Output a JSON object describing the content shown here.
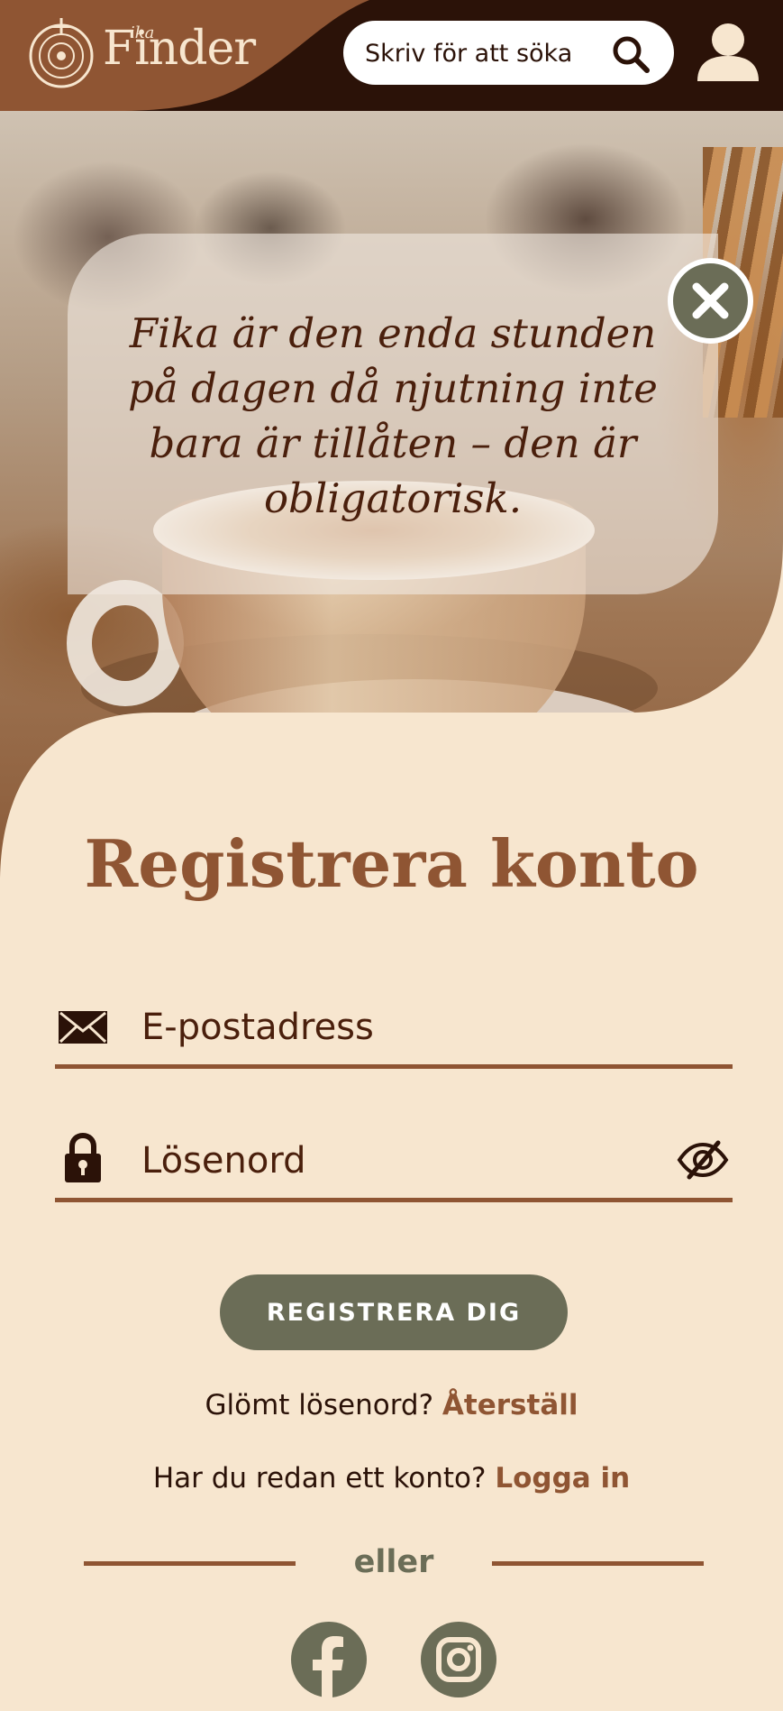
{
  "header": {
    "logo_big": "Finder",
    "logo_small": "ika",
    "search": {
      "placeholder": "Skriv för att söka"
    }
  },
  "hero": {
    "quote": "Fika är den enda stunden på dagen då njutning inte bara är tillåten – den är obligatorisk."
  },
  "form": {
    "title": "Registrera konto",
    "email_placeholder": "E-postadress",
    "password_placeholder": "Lösenord",
    "register_label": "REGISTRERA DIG",
    "forgot_text": "Glömt lösenord?",
    "forgot_link": "Återställ",
    "have_account_text": "Har du redan ett konto?",
    "login_link": "Logga in",
    "or_label": "eller"
  },
  "colors": {
    "header_dark": "#2b1208",
    "header_brown": "#8f5533",
    "background": "#f7e6cf",
    "accent_green": "#6b6d57",
    "title_brown": "#8f5533"
  },
  "icons": {
    "search": "search-icon",
    "user": "user-icon",
    "close": "close-icon",
    "email": "envelope-icon",
    "password": "lock-icon",
    "toggle_password": "eye-slash-icon",
    "facebook": "facebook-icon",
    "instagram": "instagram-icon"
  }
}
